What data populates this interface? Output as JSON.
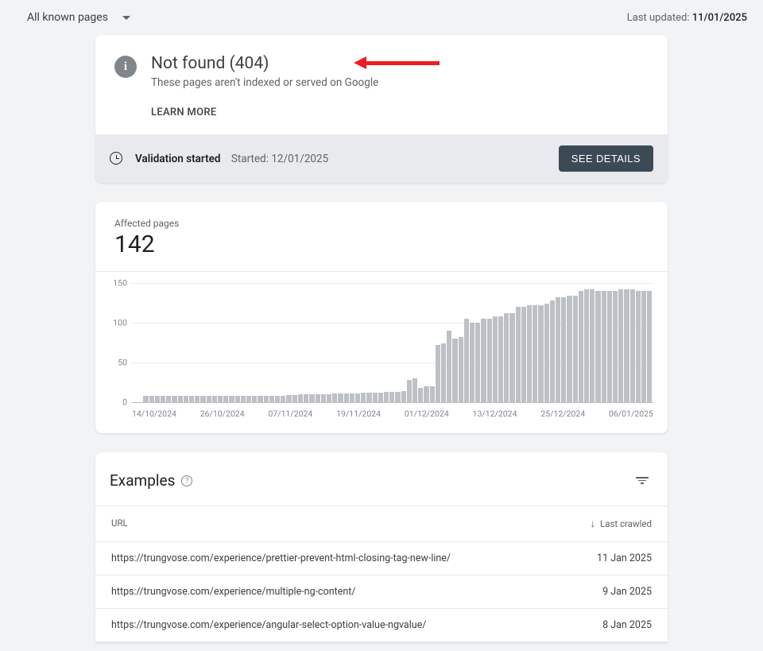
{
  "topbar": {
    "filter_label": "All known pages",
    "last_updated_label": "Last updated:",
    "last_updated_value": "11/01/2025"
  },
  "header": {
    "title": "Not found (404)",
    "subtitle": "These pages aren't indexed or served on Google",
    "learn_more": "LEARN MORE"
  },
  "validation": {
    "status": "Validation started",
    "started_label": "Started:",
    "started_date": "12/01/2025",
    "see_details": "SEE DETAILS"
  },
  "affected": {
    "label": "Affected pages",
    "value": "142"
  },
  "chart_data": {
    "type": "bar",
    "title": "Affected pages",
    "xlabel": "",
    "ylabel": "",
    "ylim": [
      0,
      150
    ],
    "y_ticks": [
      0,
      50,
      100,
      150
    ],
    "x_ticks": [
      "14/10/2024",
      "26/10/2024",
      "07/11/2024",
      "19/11/2024",
      "01/12/2024",
      "13/12/2024",
      "25/12/2024",
      "06/01/2025"
    ],
    "values": [
      0,
      0,
      8,
      8,
      8,
      8,
      8,
      8,
      8,
      8,
      8,
      8,
      8,
      8,
      8,
      8,
      8,
      8,
      8,
      8,
      8,
      8,
      8,
      8,
      8,
      8,
      8,
      9,
      9,
      10,
      10,
      10,
      10,
      10,
      10,
      11,
      11,
      11,
      11,
      11,
      12,
      12,
      12,
      12,
      13,
      13,
      13,
      14,
      28,
      30,
      18,
      20,
      20,
      72,
      74,
      90,
      80,
      82,
      105,
      100,
      100,
      105,
      105,
      108,
      108,
      112,
      112,
      120,
      120,
      122,
      122,
      122,
      124,
      128,
      132,
      132,
      134,
      134,
      140,
      142,
      142,
      140,
      140,
      140,
      140,
      142,
      142,
      142,
      140,
      140,
      140
    ]
  },
  "examples": {
    "title": "Examples",
    "columns": {
      "url": "URL",
      "last_crawled": "Last crawled"
    },
    "rows": [
      {
        "url": "https://trungvose.com/experience/prettier-prevent-html-closing-tag-new-line/",
        "date": "11 Jan 2025"
      },
      {
        "url": "https://trungvose.com/experience/multiple-ng-content/",
        "date": "9 Jan 2025"
      },
      {
        "url": "https://trungvose.com/experience/angular-select-option-value-ngvalue/",
        "date": "8 Jan 2025"
      }
    ]
  }
}
